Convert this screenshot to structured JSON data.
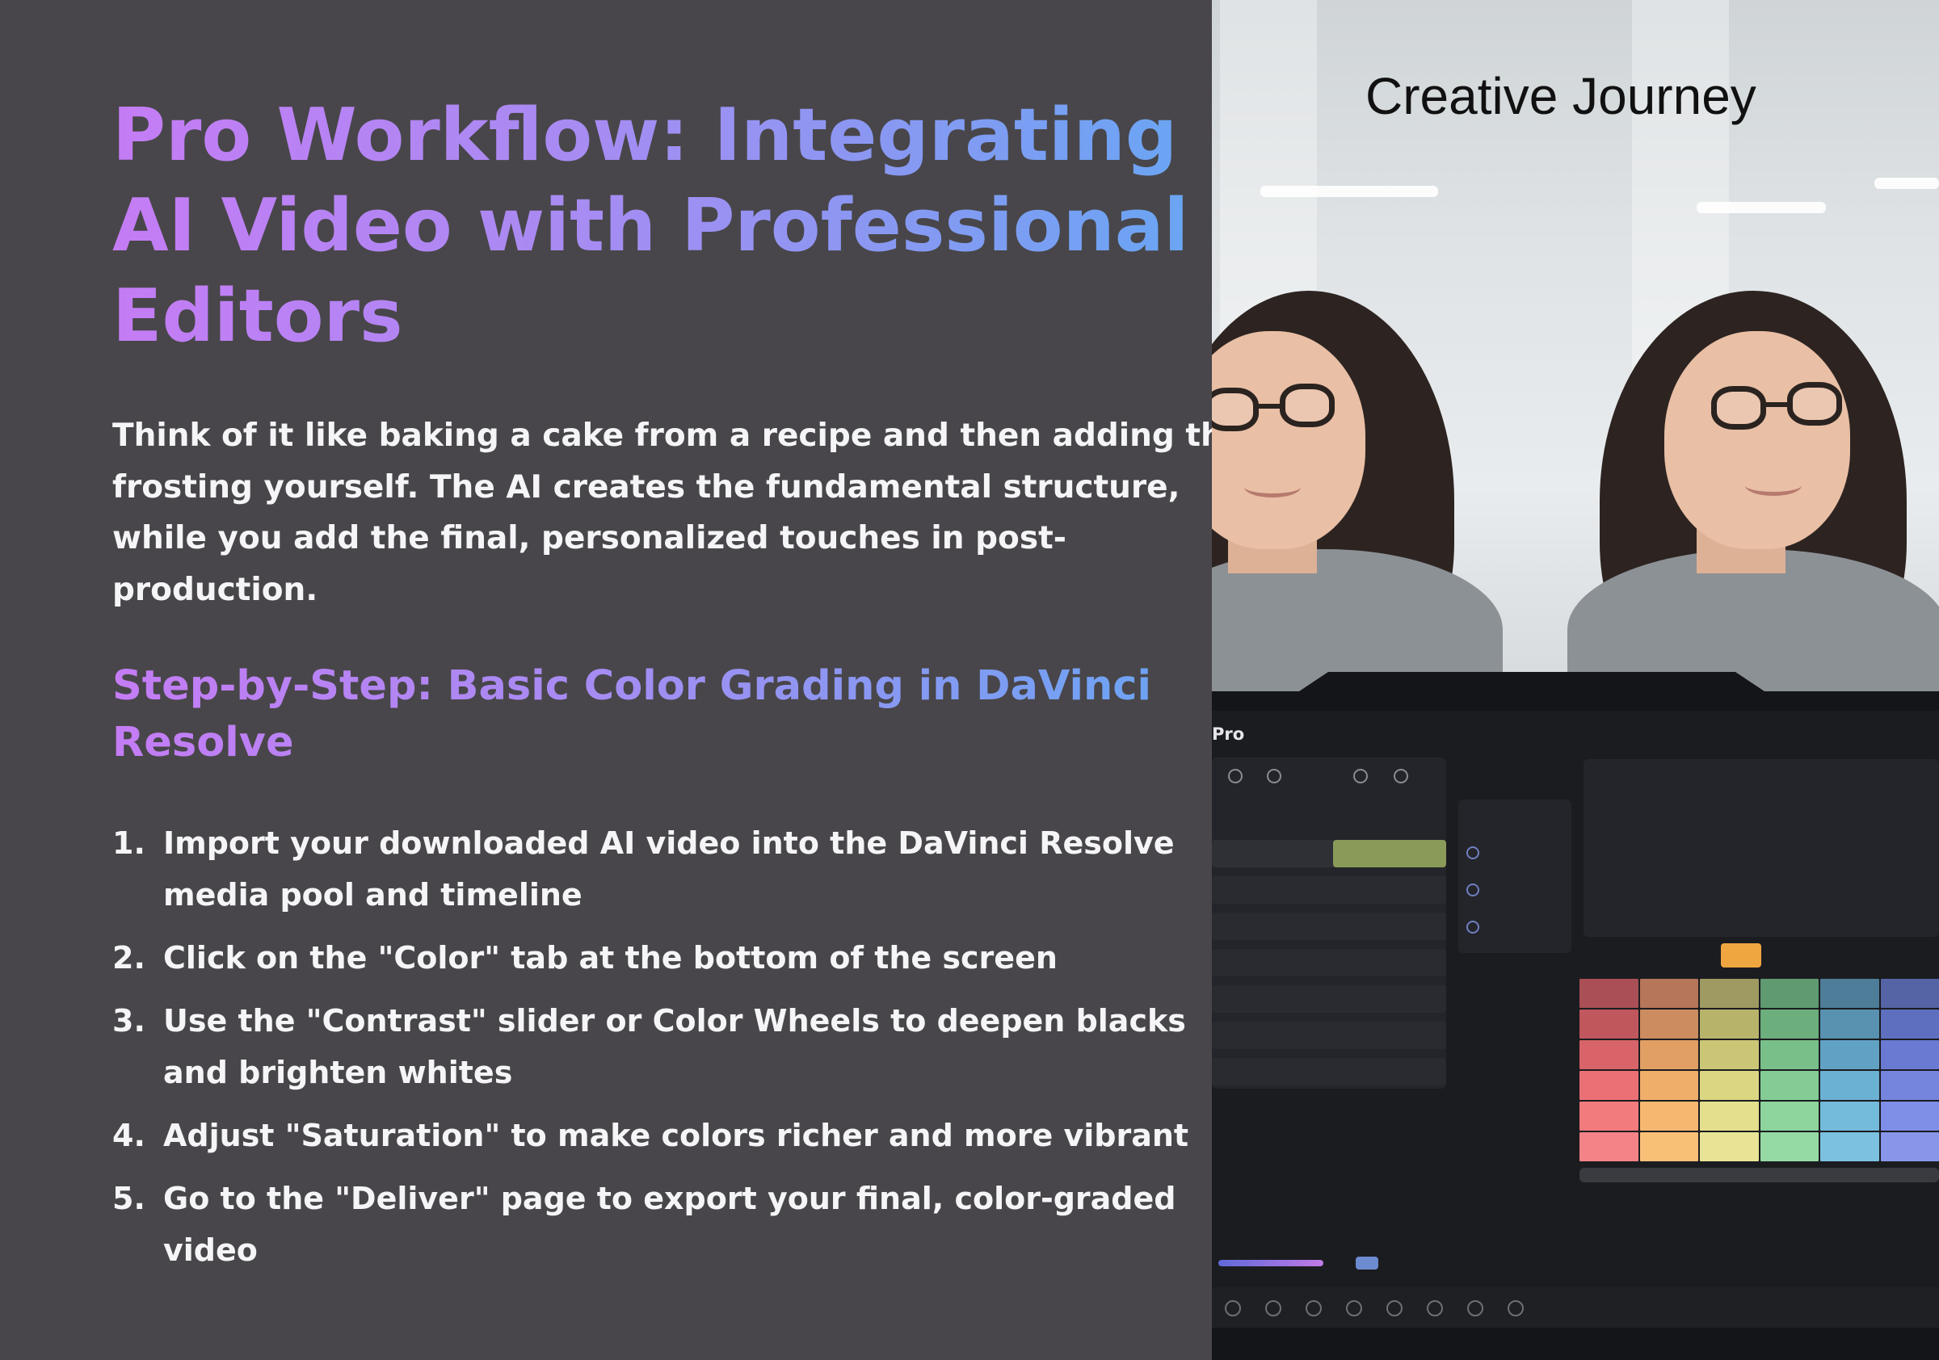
{
  "title": {
    "lines": [
      "Pro Workflow: Integrating",
      "AI Video with Professional",
      "Editors"
    ]
  },
  "intro": {
    "lines": [
      "Think of it like baking a cake from a recipe and then adding the",
      "frosting yourself. The AI creates the fundamental structure,",
      "while you add the final, personalized touches in post-",
      "production."
    ]
  },
  "subheading": {
    "lines": [
      "Step-by-Step: Basic Color Grading in DaVinci",
      "Resolve"
    ]
  },
  "steps": [
    {
      "num": "1.",
      "lines": [
        "Import your downloaded AI video into the DaVinci Resolve",
        "media pool and timeline"
      ]
    },
    {
      "num": "2.",
      "lines": [
        "Click on the \"Color\" tab at the bottom of the screen"
      ]
    },
    {
      "num": "3.",
      "lines": [
        "Use the \"Contrast\" slider or Color Wheels to deepen blacks",
        "and brighten whites"
      ]
    },
    {
      "num": "4.",
      "lines": [
        "Adjust \"Saturation\" to make colors richer and more vibrant"
      ]
    },
    {
      "num": "5.",
      "lines": [
        "Go to the \"Deliver\" page to export your final, color-graded",
        "video"
      ]
    }
  ],
  "image": {
    "caption": "Creative Journey",
    "editor_label": "Pro",
    "palette_colors": [
      "#a94f55",
      "#b6765a",
      "#9f9a62",
      "#5f9a70",
      "#4d7d98",
      "#5564a4",
      "#c0575d",
      "#cc8c5f",
      "#b8b36a",
      "#6cae7c",
      "#5892b0",
      "#5f6fbf",
      "#d8646a",
      "#e19f64",
      "#cbc676",
      "#78bf89",
      "#61a2c4",
      "#6a7ad2",
      "#ea7075",
      "#efae6a",
      "#dbd682",
      "#84cc95",
      "#6bb1d3",
      "#7585de",
      "#f27b7d",
      "#f6b870",
      "#e4df8c",
      "#8dd49d",
      "#74badb",
      "#7f8ee6",
      "#f38386",
      "#f8c077",
      "#e9e495",
      "#95d9a5",
      "#7cc1e0",
      "#8896ea"
    ]
  }
}
